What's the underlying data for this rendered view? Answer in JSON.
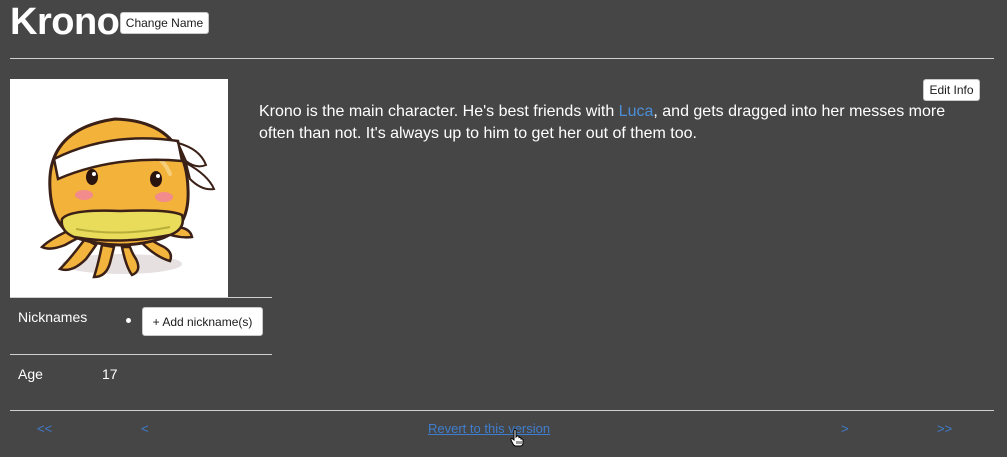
{
  "header": {
    "title": "Krono",
    "change_name_label": "Change Name"
  },
  "profile": {
    "edit_info_label": "Edit Info",
    "description_prefix": "Krono is the main character. He's best friends with ",
    "description_link": "Luca",
    "description_suffix": ", and gets dragged into her messes more often than not. It's always up to him to get her out of them too.",
    "fields": {
      "nicknames_label": "Nicknames",
      "add_nickname_label": "+ Add nickname(s)",
      "age_label": "Age",
      "age_value": "17"
    }
  },
  "footer": {
    "first_label": "<<",
    "prev_label": "<",
    "revert_label": "Revert to this version",
    "next_label": ">",
    "last_label": ">>"
  },
  "colors": {
    "background": "#464646",
    "link": "#4d8fd6"
  }
}
